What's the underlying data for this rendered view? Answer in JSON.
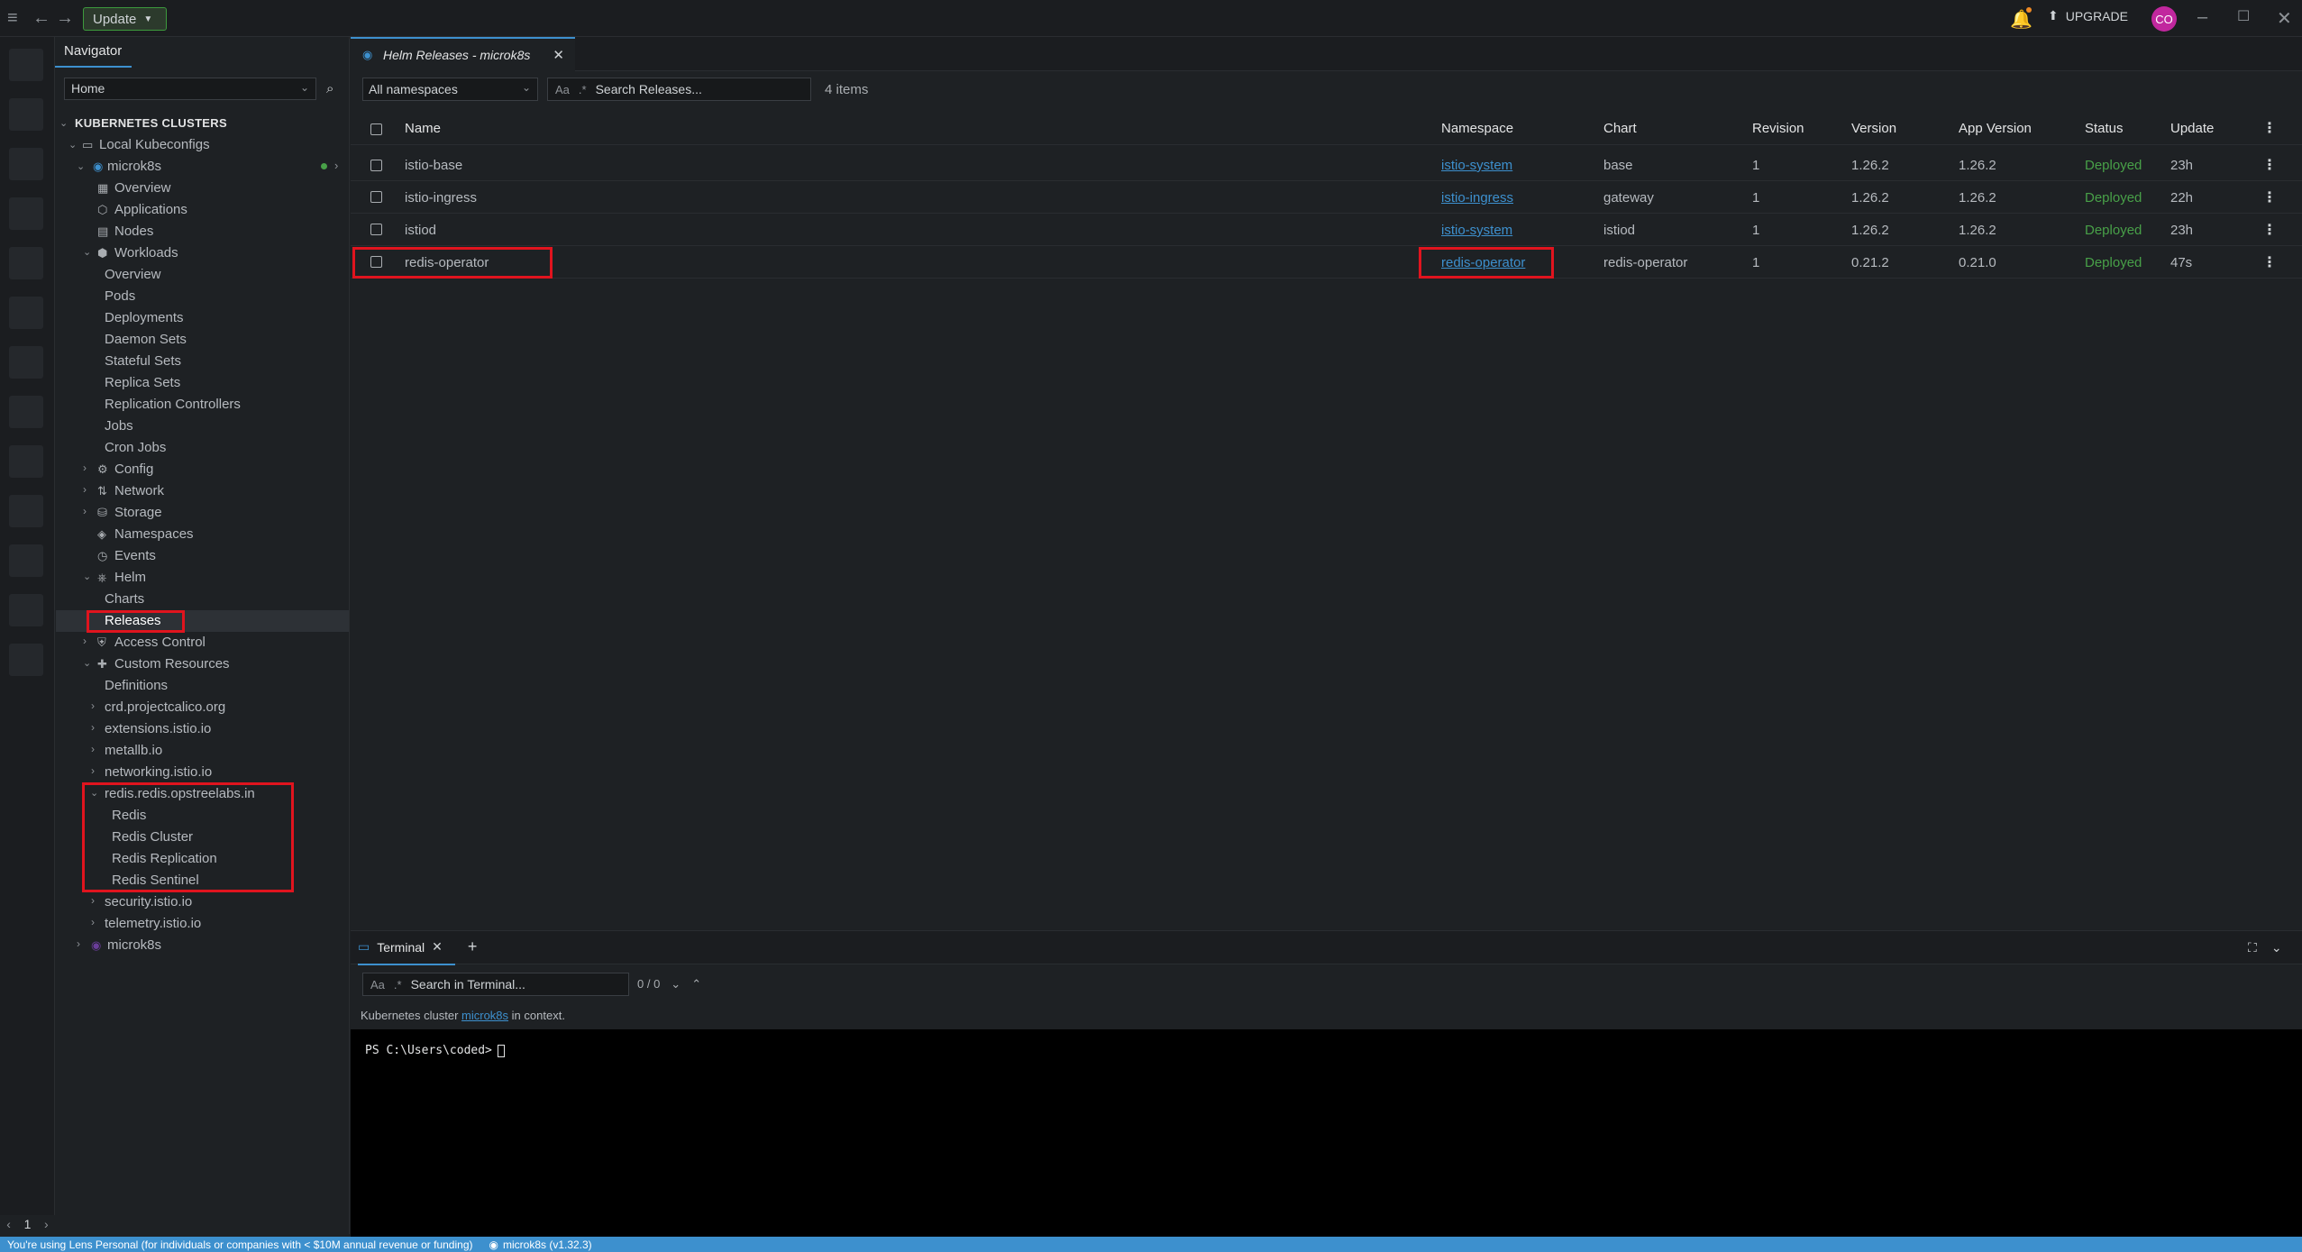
{
  "topbar": {
    "update_label": "Update",
    "upgrade_label": "UPGRADE",
    "avatar_initials": "CO"
  },
  "hotbar": {
    "page_number": "1"
  },
  "navigator": {
    "title": "Navigator",
    "select_value": "Home",
    "tree": {
      "kubernetes_clusters": "KUBERNETES CLUSTERS",
      "local_kubeconfigs": "Local Kubeconfigs",
      "cluster1": "microk8s",
      "overview": "Overview",
      "applications": "Applications",
      "nodes": "Nodes",
      "workloads": "Workloads",
      "w_overview": "Overview",
      "pods": "Pods",
      "deployments": "Deployments",
      "daemon_sets": "Daemon Sets",
      "stateful_sets": "Stateful Sets",
      "replica_sets": "Replica Sets",
      "replication_controllers": "Replication Controllers",
      "jobs": "Jobs",
      "cron_jobs": "Cron Jobs",
      "config": "Config",
      "network": "Network",
      "storage": "Storage",
      "namespaces": "Namespaces",
      "events": "Events",
      "helm": "Helm",
      "charts": "Charts",
      "releases": "Releases",
      "access_control": "Access Control",
      "custom_resources": "Custom Resources",
      "definitions": "Definitions",
      "crd1": "crd.projectcalico.org",
      "crd2": "extensions.istio.io",
      "crd3": "metallb.io",
      "crd4": "networking.istio.io",
      "crd5": "redis.redis.opstreelabs.in",
      "redis": "Redis",
      "redis_cluster": "Redis Cluster",
      "redis_replication": "Redis Replication",
      "redis_sentinel": "Redis Sentinel",
      "crd6": "security.istio.io",
      "crd7": "telemetry.istio.io",
      "cluster2": "microk8s"
    }
  },
  "main": {
    "tab_label": "Helm Releases - microk8s",
    "namespace_select": "All namespaces",
    "search_placeholder": "Search Releases...",
    "search_toggle": "Aa",
    "items_count": "4 items",
    "columns": {
      "name": "Name",
      "namespace": "Namespace",
      "chart": "Chart",
      "revision": "Revision",
      "version": "Version",
      "app_version": "App Version",
      "status": "Status",
      "updated": "Update"
    },
    "rows": [
      {
        "name": "istio-base",
        "namespace": "istio-system",
        "chart": "base",
        "revision": "1",
        "version": "1.26.2",
        "app_version": "1.26.2",
        "status": "Deployed",
        "updated": "23h"
      },
      {
        "name": "istio-ingress",
        "namespace": "istio-ingress",
        "chart": "gateway",
        "revision": "1",
        "version": "1.26.2",
        "app_version": "1.26.2",
        "status": "Deployed",
        "updated": "22h"
      },
      {
        "name": "istiod",
        "namespace": "istio-system",
        "chart": "istiod",
        "revision": "1",
        "version": "1.26.2",
        "app_version": "1.26.2",
        "status": "Deployed",
        "updated": "23h"
      },
      {
        "name": "redis-operator",
        "namespace": "redis-operator",
        "chart": "redis-operator",
        "revision": "1",
        "version": "0.21.2",
        "app_version": "0.21.0",
        "status": "Deployed",
        "updated": "47s"
      }
    ]
  },
  "dock": {
    "terminal_tab": "Terminal",
    "search_placeholder": "Search in Terminal...",
    "search_toggle": "Aa",
    "match_count": "0 / 0",
    "info_prefix": "Kubernetes cluster",
    "info_link": "microk8s",
    "info_suffix": "in context.",
    "prompt": "PS C:\\Users\\coded>"
  },
  "statusbar": {
    "license_text": "You're using Lens Personal (for individuals or companies with < $10M annual revenue or funding)",
    "cluster_text": "microk8s (v1.32.3)"
  },
  "colors": {
    "accent": "#3d90ce",
    "status_deployed": "#48a048",
    "highlight_box": "#e0141e",
    "avatar": "#c1279e"
  },
  "icons": [
    "menu-icon",
    "back-arrow-icon",
    "forward-arrow-icon",
    "bell-icon",
    "upgrade-icon",
    "minimize-icon",
    "maximize-icon",
    "close-icon",
    "search-icon",
    "kebab-icon",
    "plus-icon",
    "fullscreen-icon",
    "chevron-down-icon"
  ]
}
